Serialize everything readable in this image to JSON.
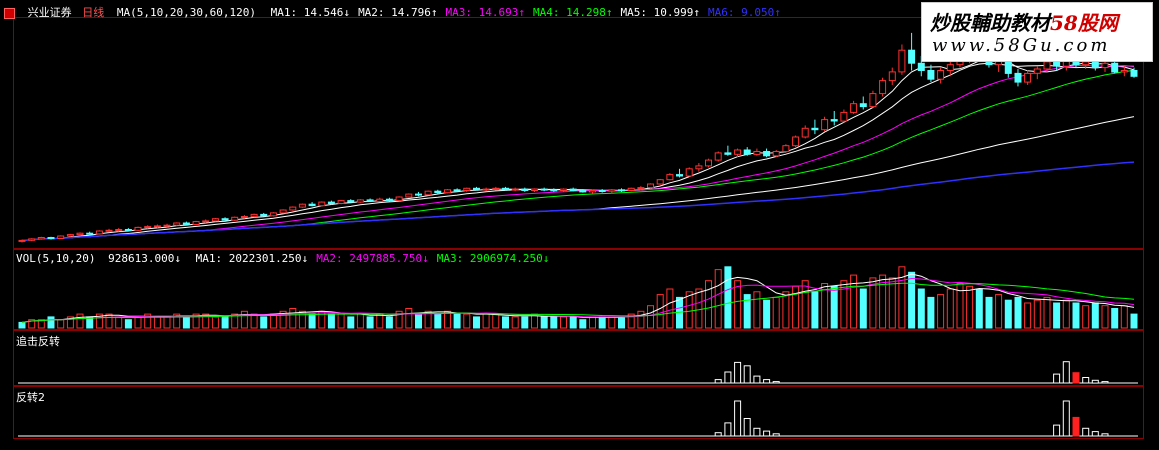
{
  "app": {
    "stock_name": "兴业证券",
    "period": "日线",
    "watermark_title": "炒股輔助教材",
    "watermark_brand": "58股网",
    "watermark_url": "www.58Gu.com"
  },
  "price_panel": {
    "ma_params": "MA(5,10,20,30,60,120)",
    "ma_values": [
      {
        "label": "MA1",
        "value": "14.546",
        "arrow": "↓",
        "color": "#ffffff"
      },
      {
        "label": "MA2",
        "value": "14.796",
        "arrow": "↑",
        "color": "#ffffff"
      },
      {
        "label": "MA3",
        "value": "14.693",
        "arrow": "↑",
        "color": "#ff00ff"
      },
      {
        "label": "MA4",
        "value": "14.298",
        "arrow": "↑",
        "color": "#00ff00"
      },
      {
        "label": "MA5",
        "value": "10.999",
        "arrow": "↑",
        "color": "#ffffff"
      },
      {
        "label": "MA6",
        "value": "9.050",
        "arrow": "↑",
        "color": "#3030ff"
      }
    ]
  },
  "volume_panel": {
    "params": "VOL(5,10,20)",
    "vol_value": "928613.000",
    "vol_arrow": "↓",
    "ma_values": [
      {
        "label": "MA1",
        "value": "2022301.250",
        "arrow": "↓",
        "color": "#ffffff"
      },
      {
        "label": "MA2",
        "value": "2497885.750",
        "arrow": "↓",
        "color": "#ff00ff"
      },
      {
        "label": "MA3",
        "value": "2906974.250",
        "arrow": "↓",
        "color": "#00ff00"
      }
    ]
  },
  "indicator1": {
    "label": "追击反转"
  },
  "indicator2": {
    "label": "反转2"
  },
  "chart_data": {
    "type": "candlestick",
    "candles": [
      [
        0,
        3.2,
        3.3,
        3.1,
        3.25
      ],
      [
        1,
        3.25,
        3.4,
        3.2,
        3.35
      ],
      [
        2,
        3.35,
        3.5,
        3.3,
        3.45
      ],
      [
        3,
        3.45,
        3.5,
        3.3,
        3.38
      ],
      [
        4,
        3.38,
        3.6,
        3.35,
        3.55
      ],
      [
        5,
        3.55,
        3.7,
        3.5,
        3.65
      ],
      [
        6,
        3.65,
        3.8,
        3.55,
        3.75
      ],
      [
        7,
        3.75,
        3.85,
        3.6,
        3.7
      ],
      [
        8,
        3.7,
        3.95,
        3.65,
        3.9
      ],
      [
        9,
        3.9,
        4.05,
        3.8,
        3.95
      ],
      [
        10,
        3.95,
        4.1,
        3.85,
        4.0
      ],
      [
        11,
        4.0,
        4.1,
        3.9,
        3.95
      ],
      [
        12,
        3.95,
        4.2,
        3.9,
        4.15
      ],
      [
        13,
        4.15,
        4.3,
        4.05,
        4.2
      ],
      [
        14,
        4.2,
        4.35,
        4.1,
        4.25
      ],
      [
        15,
        4.25,
        4.4,
        4.15,
        4.3
      ],
      [
        16,
        4.3,
        4.5,
        4.25,
        4.45
      ],
      [
        17,
        4.45,
        4.55,
        4.3,
        4.35
      ],
      [
        18,
        4.35,
        4.6,
        4.3,
        4.55
      ],
      [
        19,
        4.55,
        4.7,
        4.45,
        4.6
      ],
      [
        20,
        4.6,
        4.8,
        4.55,
        4.75
      ],
      [
        21,
        4.75,
        4.85,
        4.6,
        4.65
      ],
      [
        22,
        4.65,
        4.9,
        4.6,
        4.85
      ],
      [
        23,
        4.85,
        5.0,
        4.75,
        4.9
      ],
      [
        24,
        4.9,
        5.1,
        4.85,
        5.05
      ],
      [
        25,
        5.05,
        5.15,
        4.9,
        4.95
      ],
      [
        26,
        4.95,
        5.2,
        4.9,
        5.15
      ],
      [
        27,
        5.15,
        5.4,
        5.1,
        5.35
      ],
      [
        28,
        5.35,
        5.6,
        5.3,
        5.55
      ],
      [
        29,
        5.55,
        5.8,
        5.5,
        5.75
      ],
      [
        30,
        5.75,
        5.9,
        5.6,
        5.65
      ],
      [
        31,
        5.65,
        5.95,
        5.6,
        5.9
      ],
      [
        32,
        5.9,
        6.0,
        5.7,
        5.8
      ],
      [
        33,
        5.8,
        6.05,
        5.75,
        6.0
      ],
      [
        34,
        6.0,
        6.1,
        5.85,
        5.9
      ],
      [
        35,
        5.9,
        6.1,
        5.85,
        6.05
      ],
      [
        36,
        6.05,
        6.15,
        5.9,
        5.95
      ],
      [
        37,
        5.95,
        6.2,
        5.9,
        6.1
      ],
      [
        38,
        6.1,
        6.2,
        5.95,
        6.0
      ],
      [
        39,
        6.0,
        6.3,
        5.95,
        6.25
      ],
      [
        40,
        6.25,
        6.5,
        6.2,
        6.45
      ],
      [
        41,
        6.45,
        6.6,
        6.3,
        6.4
      ],
      [
        42,
        6.4,
        6.7,
        6.35,
        6.65
      ],
      [
        43,
        6.65,
        6.75,
        6.5,
        6.55
      ],
      [
        44,
        6.55,
        6.8,
        6.5,
        6.75
      ],
      [
        45,
        6.75,
        6.85,
        6.6,
        6.7
      ],
      [
        46,
        6.7,
        6.9,
        6.6,
        6.85
      ],
      [
        47,
        6.85,
        6.95,
        6.7,
        6.75
      ],
      [
        48,
        6.75,
        6.9,
        6.65,
        6.8
      ],
      [
        49,
        6.8,
        6.95,
        6.7,
        6.85
      ],
      [
        50,
        6.85,
        6.95,
        6.7,
        6.75
      ],
      [
        51,
        6.75,
        6.9,
        6.65,
        6.8
      ],
      [
        52,
        6.8,
        6.9,
        6.6,
        6.7
      ],
      [
        53,
        6.7,
        6.85,
        6.6,
        6.8
      ],
      [
        54,
        6.8,
        6.9,
        6.65,
        6.75
      ],
      [
        55,
        6.75,
        6.85,
        6.6,
        6.7
      ],
      [
        56,
        6.7,
        6.85,
        6.6,
        6.8
      ],
      [
        57,
        6.8,
        6.9,
        6.65,
        6.7
      ],
      [
        58,
        6.7,
        6.8,
        6.55,
        6.6
      ],
      [
        59,
        6.6,
        6.75,
        6.5,
        6.7
      ],
      [
        60,
        6.7,
        6.8,
        6.55,
        6.65
      ],
      [
        61,
        6.65,
        6.8,
        6.5,
        6.75
      ],
      [
        62,
        6.75,
        6.85,
        6.6,
        6.7
      ],
      [
        63,
        6.7,
        6.9,
        6.65,
        6.85
      ],
      [
        64,
        6.85,
        7.0,
        6.7,
        6.9
      ],
      [
        65,
        6.9,
        7.2,
        6.85,
        7.15
      ],
      [
        66,
        7.15,
        7.5,
        7.1,
        7.45
      ],
      [
        67,
        7.45,
        7.9,
        7.4,
        7.8
      ],
      [
        68,
        7.8,
        8.2,
        7.6,
        7.7
      ],
      [
        69,
        7.7,
        8.3,
        7.65,
        8.2
      ],
      [
        70,
        8.2,
        8.6,
        8.0,
        8.4
      ],
      [
        71,
        8.4,
        8.9,
        8.3,
        8.8
      ],
      [
        72,
        8.8,
        9.4,
        8.7,
        9.3
      ],
      [
        73,
        9.3,
        9.8,
        9.1,
        9.2
      ],
      [
        74,
        9.2,
        9.6,
        9.0,
        9.5
      ],
      [
        75,
        9.5,
        9.7,
        9.1,
        9.2
      ],
      [
        76,
        9.2,
        9.6,
        9.1,
        9.4
      ],
      [
        77,
        9.4,
        9.6,
        9.0,
        9.1
      ],
      [
        78,
        9.1,
        9.5,
        9.0,
        9.4
      ],
      [
        79,
        9.4,
        9.9,
        9.3,
        9.8
      ],
      [
        80,
        9.8,
        10.5,
        9.7,
        10.4
      ],
      [
        81,
        10.4,
        11.2,
        10.3,
        11.0
      ],
      [
        82,
        11.0,
        11.6,
        10.6,
        10.9
      ],
      [
        83,
        10.9,
        11.8,
        10.8,
        11.6
      ],
      [
        84,
        11.6,
        12.2,
        11.2,
        11.5
      ],
      [
        85,
        11.5,
        12.3,
        11.4,
        12.1
      ],
      [
        86,
        12.1,
        12.9,
        12.0,
        12.7
      ],
      [
        87,
        12.7,
        13.2,
        12.3,
        12.5
      ],
      [
        88,
        12.5,
        13.6,
        12.4,
        13.4
      ],
      [
        89,
        13.4,
        14.5,
        13.2,
        14.3
      ],
      [
        90,
        14.3,
        15.2,
        14.0,
        14.9
      ],
      [
        91,
        14.9,
        16.8,
        14.7,
        16.4
      ],
      [
        92,
        16.4,
        17.6,
        15.0,
        15.5
      ],
      [
        93,
        15.5,
        16.0,
        14.6,
        15.0
      ],
      [
        94,
        15.0,
        15.4,
        14.2,
        14.4
      ],
      [
        95,
        14.4,
        15.2,
        14.1,
        15.0
      ],
      [
        96,
        15.0,
        15.6,
        14.6,
        15.4
      ],
      [
        97,
        15.4,
        16.1,
        15.2,
        15.8
      ],
      [
        98,
        15.8,
        16.5,
        15.5,
        16.2
      ],
      [
        99,
        16.2,
        17.0,
        15.6,
        15.9
      ],
      [
        100,
        15.9,
        16.3,
        15.2,
        15.4
      ],
      [
        101,
        15.4,
        15.9,
        14.9,
        15.7
      ],
      [
        102,
        15.7,
        16.0,
        14.5,
        14.8
      ],
      [
        103,
        14.8,
        15.1,
        13.9,
        14.2
      ],
      [
        104,
        14.2,
        15.0,
        14.0,
        14.8
      ],
      [
        105,
        14.8,
        15.3,
        14.4,
        15.1
      ],
      [
        106,
        15.1,
        15.8,
        14.9,
        15.6
      ],
      [
        107,
        15.6,
        16.0,
        15.0,
        15.3
      ],
      [
        108,
        15.3,
        15.9,
        15.0,
        15.7
      ],
      [
        109,
        15.7,
        16.1,
        15.2,
        15.4
      ],
      [
        110,
        15.4,
        15.9,
        15.1,
        15.6
      ],
      [
        111,
        15.6,
        15.8,
        15.0,
        15.2
      ],
      [
        112,
        15.2,
        15.7,
        14.9,
        15.5
      ],
      [
        113,
        15.5,
        15.6,
        14.8,
        14.9
      ],
      [
        114,
        14.9,
        15.3,
        14.6,
        15.0
      ],
      [
        115,
        15.0,
        15.2,
        14.5,
        14.6
      ]
    ],
    "volume": [
      [
        0,
        2,
        0
      ],
      [
        1,
        3,
        1
      ],
      [
        2,
        3,
        1
      ],
      [
        3,
        4,
        0
      ],
      [
        4,
        3,
        1
      ],
      [
        5,
        4,
        1
      ],
      [
        6,
        5,
        1
      ],
      [
        7,
        4,
        0
      ],
      [
        8,
        5,
        1
      ],
      [
        9,
        5,
        1
      ],
      [
        10,
        4,
        1
      ],
      [
        11,
        3,
        0
      ],
      [
        12,
        4,
        1
      ],
      [
        13,
        5,
        1
      ],
      [
        14,
        4,
        1
      ],
      [
        15,
        4,
        1
      ],
      [
        16,
        5,
        1
      ],
      [
        17,
        4,
        0
      ],
      [
        18,
        5,
        1
      ],
      [
        19,
        5,
        1
      ],
      [
        20,
        4,
        1
      ],
      [
        21,
        4,
        0
      ],
      [
        22,
        5,
        1
      ],
      [
        23,
        6,
        1
      ],
      [
        24,
        5,
        1
      ],
      [
        25,
        4,
        0
      ],
      [
        26,
        5,
        1
      ],
      [
        27,
        6,
        1
      ],
      [
        28,
        7,
        1
      ],
      [
        29,
        6,
        1
      ],
      [
        30,
        5,
        0
      ],
      [
        31,
        6,
        1
      ],
      [
        32,
        5,
        0
      ],
      [
        33,
        5,
        1
      ],
      [
        34,
        4,
        0
      ],
      [
        35,
        5,
        1
      ],
      [
        36,
        4,
        0
      ],
      [
        37,
        5,
        1
      ],
      [
        38,
        4,
        0
      ],
      [
        39,
        6,
        1
      ],
      [
        40,
        7,
        1
      ],
      [
        41,
        5,
        0
      ],
      [
        42,
        6,
        1
      ],
      [
        43,
        5,
        0
      ],
      [
        44,
        6,
        1
      ],
      [
        45,
        5,
        0
      ],
      [
        46,
        5,
        1
      ],
      [
        47,
        4,
        0
      ],
      [
        48,
        5,
        1
      ],
      [
        49,
        5,
        1
      ],
      [
        50,
        4,
        0
      ],
      [
        51,
        4,
        1
      ],
      [
        52,
        4,
        0
      ],
      [
        53,
        5,
        1
      ],
      [
        54,
        4,
        0
      ],
      [
        55,
        4,
        0
      ],
      [
        56,
        4,
        1
      ],
      [
        57,
        4,
        0
      ],
      [
        58,
        3,
        0
      ],
      [
        59,
        4,
        1
      ],
      [
        60,
        4,
        0
      ],
      [
        61,
        4,
        1
      ],
      [
        62,
        4,
        0
      ],
      [
        63,
        5,
        1
      ],
      [
        64,
        6,
        1
      ],
      [
        65,
        8,
        1
      ],
      [
        66,
        12,
        1
      ],
      [
        67,
        14,
        1
      ],
      [
        68,
        11,
        0
      ],
      [
        69,
        13,
        1
      ],
      [
        70,
        14,
        1
      ],
      [
        71,
        17,
        1
      ],
      [
        72,
        21,
        1
      ],
      [
        73,
        22,
        0
      ],
      [
        74,
        17,
        1
      ],
      [
        75,
        12,
        0
      ],
      [
        76,
        13,
        1
      ],
      [
        77,
        10,
        0
      ],
      [
        78,
        11,
        1
      ],
      [
        79,
        13,
        1
      ],
      [
        80,
        15,
        1
      ],
      [
        81,
        17,
        1
      ],
      [
        82,
        13,
        0
      ],
      [
        83,
        16,
        1
      ],
      [
        84,
        15,
        0
      ],
      [
        85,
        17,
        1
      ],
      [
        86,
        19,
        1
      ],
      [
        87,
        14,
        0
      ],
      [
        88,
        18,
        1
      ],
      [
        89,
        19,
        1
      ],
      [
        90,
        18,
        1
      ],
      [
        91,
        22,
        1
      ],
      [
        92,
        20,
        0
      ],
      [
        93,
        14,
        0
      ],
      [
        94,
        11,
        0
      ],
      [
        95,
        12,
        1
      ],
      [
        96,
        14,
        1
      ],
      [
        97,
        16,
        1
      ],
      [
        98,
        15,
        1
      ],
      [
        99,
        14,
        0
      ],
      [
        100,
        11,
        0
      ],
      [
        101,
        12,
        1
      ],
      [
        102,
        10,
        0
      ],
      [
        103,
        11,
        0
      ],
      [
        104,
        9,
        1
      ],
      [
        105,
        10,
        1
      ],
      [
        106,
        11,
        1
      ],
      [
        107,
        9,
        0
      ],
      [
        108,
        10,
        1
      ],
      [
        109,
        9,
        0
      ],
      [
        110,
        8,
        1
      ],
      [
        111,
        9,
        0
      ],
      [
        112,
        8,
        1
      ],
      [
        113,
        7,
        0
      ],
      [
        114,
        8,
        1
      ],
      [
        115,
        5,
        0
      ]
    ],
    "indicator1": [
      [
        72,
        1.0,
        "w"
      ],
      [
        73,
        3.2,
        "w"
      ],
      [
        74,
        6.0,
        "w"
      ],
      [
        75,
        5.0,
        "w"
      ],
      [
        76,
        2.0,
        "w"
      ],
      [
        77,
        1.0,
        "w"
      ],
      [
        78,
        0.4,
        "w"
      ],
      [
        107,
        2.6,
        "w"
      ],
      [
        108,
        6.2,
        "w"
      ],
      [
        109,
        3.0,
        "r"
      ],
      [
        110,
        1.6,
        "w"
      ],
      [
        111,
        0.8,
        "w"
      ],
      [
        112,
        0.4,
        "w"
      ]
    ],
    "indicator2": [
      [
        72,
        0.6,
        "w"
      ],
      [
        73,
        2.4,
        "w"
      ],
      [
        74,
        6.4,
        "w"
      ],
      [
        75,
        3.2,
        "w"
      ],
      [
        76,
        1.4,
        "w"
      ],
      [
        77,
        0.9,
        "w"
      ],
      [
        78,
        0.4,
        "w"
      ],
      [
        107,
        2.0,
        "w"
      ],
      [
        108,
        6.4,
        "w"
      ],
      [
        109,
        3.4,
        "r"
      ],
      [
        110,
        1.4,
        "w"
      ],
      [
        111,
        0.8,
        "w"
      ],
      [
        112,
        0.4,
        "w"
      ]
    ]
  }
}
